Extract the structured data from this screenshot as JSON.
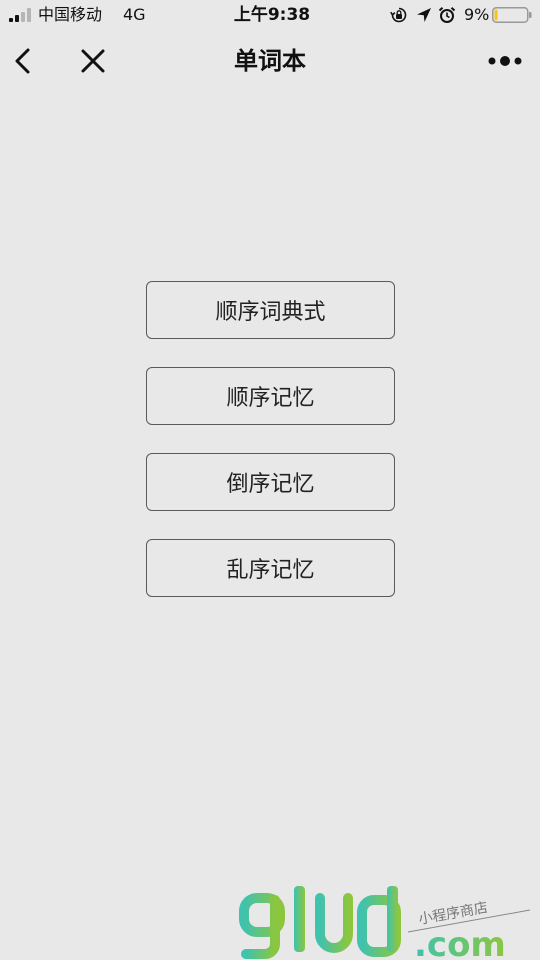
{
  "status_bar": {
    "carrier": "中国移动",
    "network": "4G",
    "time": "上午9:38",
    "battery_percent": "9%",
    "battery_level": 0.09,
    "icons": [
      "signal-icon",
      "rotation-lock-icon",
      "location-arrow-icon",
      "alarm-icon",
      "battery-icon"
    ]
  },
  "nav": {
    "title": "单词本",
    "back_icon": "chevron-left-icon",
    "close_icon": "close-icon",
    "more_icon": "more-dots-icon"
  },
  "menu": {
    "items": [
      {
        "label": "顺序词典式"
      },
      {
        "label": "顺序记忆"
      },
      {
        "label": "倒序记忆"
      },
      {
        "label": "乱序记忆"
      }
    ]
  },
  "watermark": {
    "logo": "glud",
    "tagline": "小程序商店",
    "domain": ".com"
  },
  "colors": {
    "background": "#e8e8e8",
    "button_border": "#5a5a5a",
    "battery_low": "#f5c518",
    "watermark_teal": "#3fc2ae",
    "watermark_green": "#8cc63f"
  }
}
